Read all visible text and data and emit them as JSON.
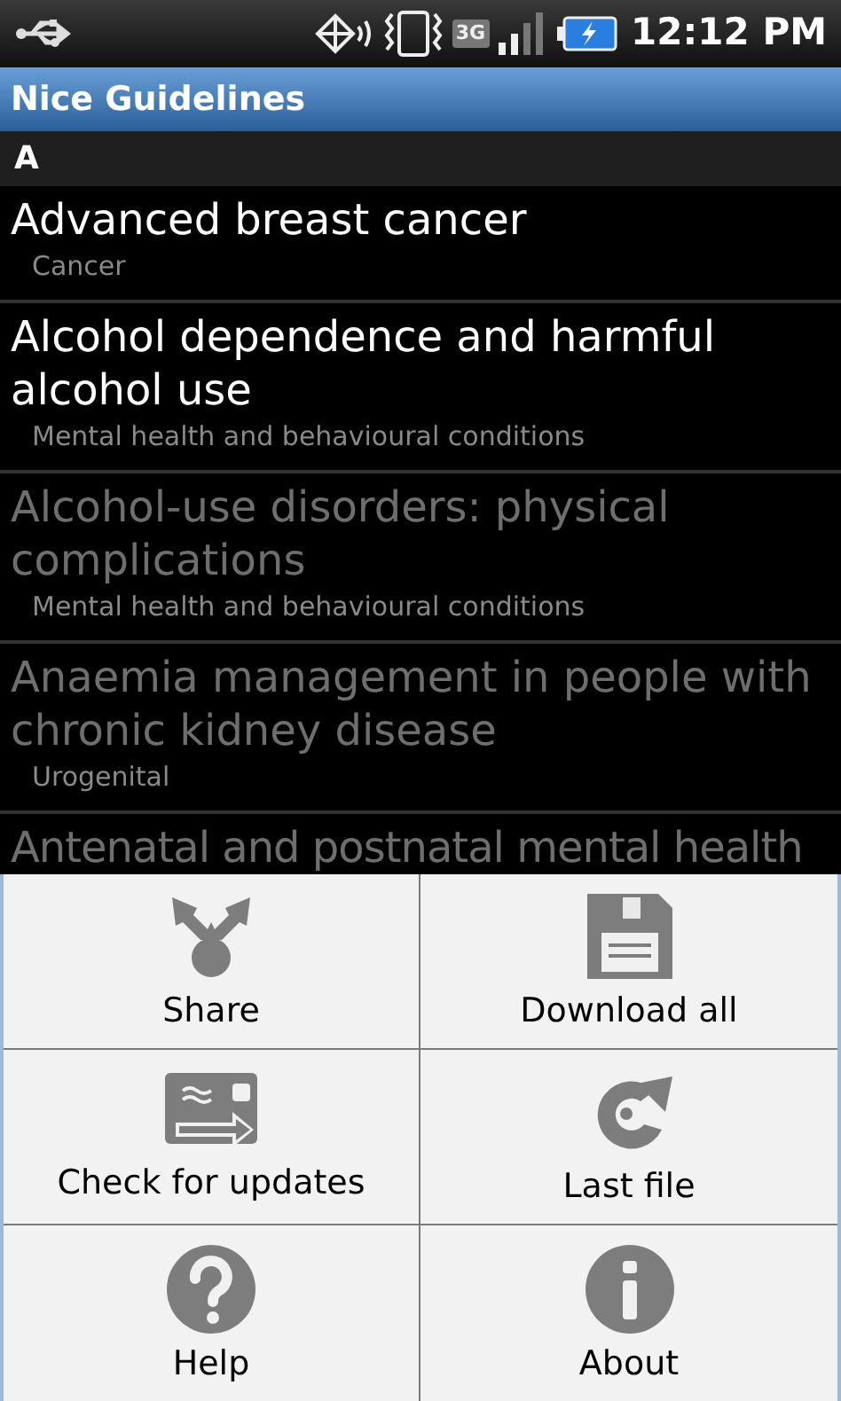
{
  "status_bar": {
    "network": "3G",
    "time": "12:12 PM"
  },
  "app_bar": {
    "title": "Nice Guidelines"
  },
  "list": {
    "section": "A",
    "items": [
      {
        "title": "Advanced breast cancer",
        "category": "Cancer",
        "disabled": false
      },
      {
        "title": "Alcohol dependence and harmful alcohol use",
        "category": "Mental health and behavioural conditions",
        "disabled": false
      },
      {
        "title": "Alcohol-use disorders: physical complications",
        "category": "Mental health and behavioural conditions",
        "disabled": true
      },
      {
        "title": "Anaemia management in people with chronic kidney disease",
        "category": "Urogenital",
        "disabled": true
      },
      {
        "title": "Antenatal and postnatal mental health",
        "disabled": true
      }
    ]
  },
  "menu": {
    "items": [
      {
        "label": "Share",
        "kind": "share"
      },
      {
        "label": "Download all",
        "kind": "download"
      },
      {
        "label": "Check for updates",
        "kind": "update"
      },
      {
        "label": "Last file",
        "kind": "last"
      },
      {
        "label": "Help",
        "kind": "help"
      },
      {
        "label": "About",
        "kind": "about"
      }
    ]
  }
}
